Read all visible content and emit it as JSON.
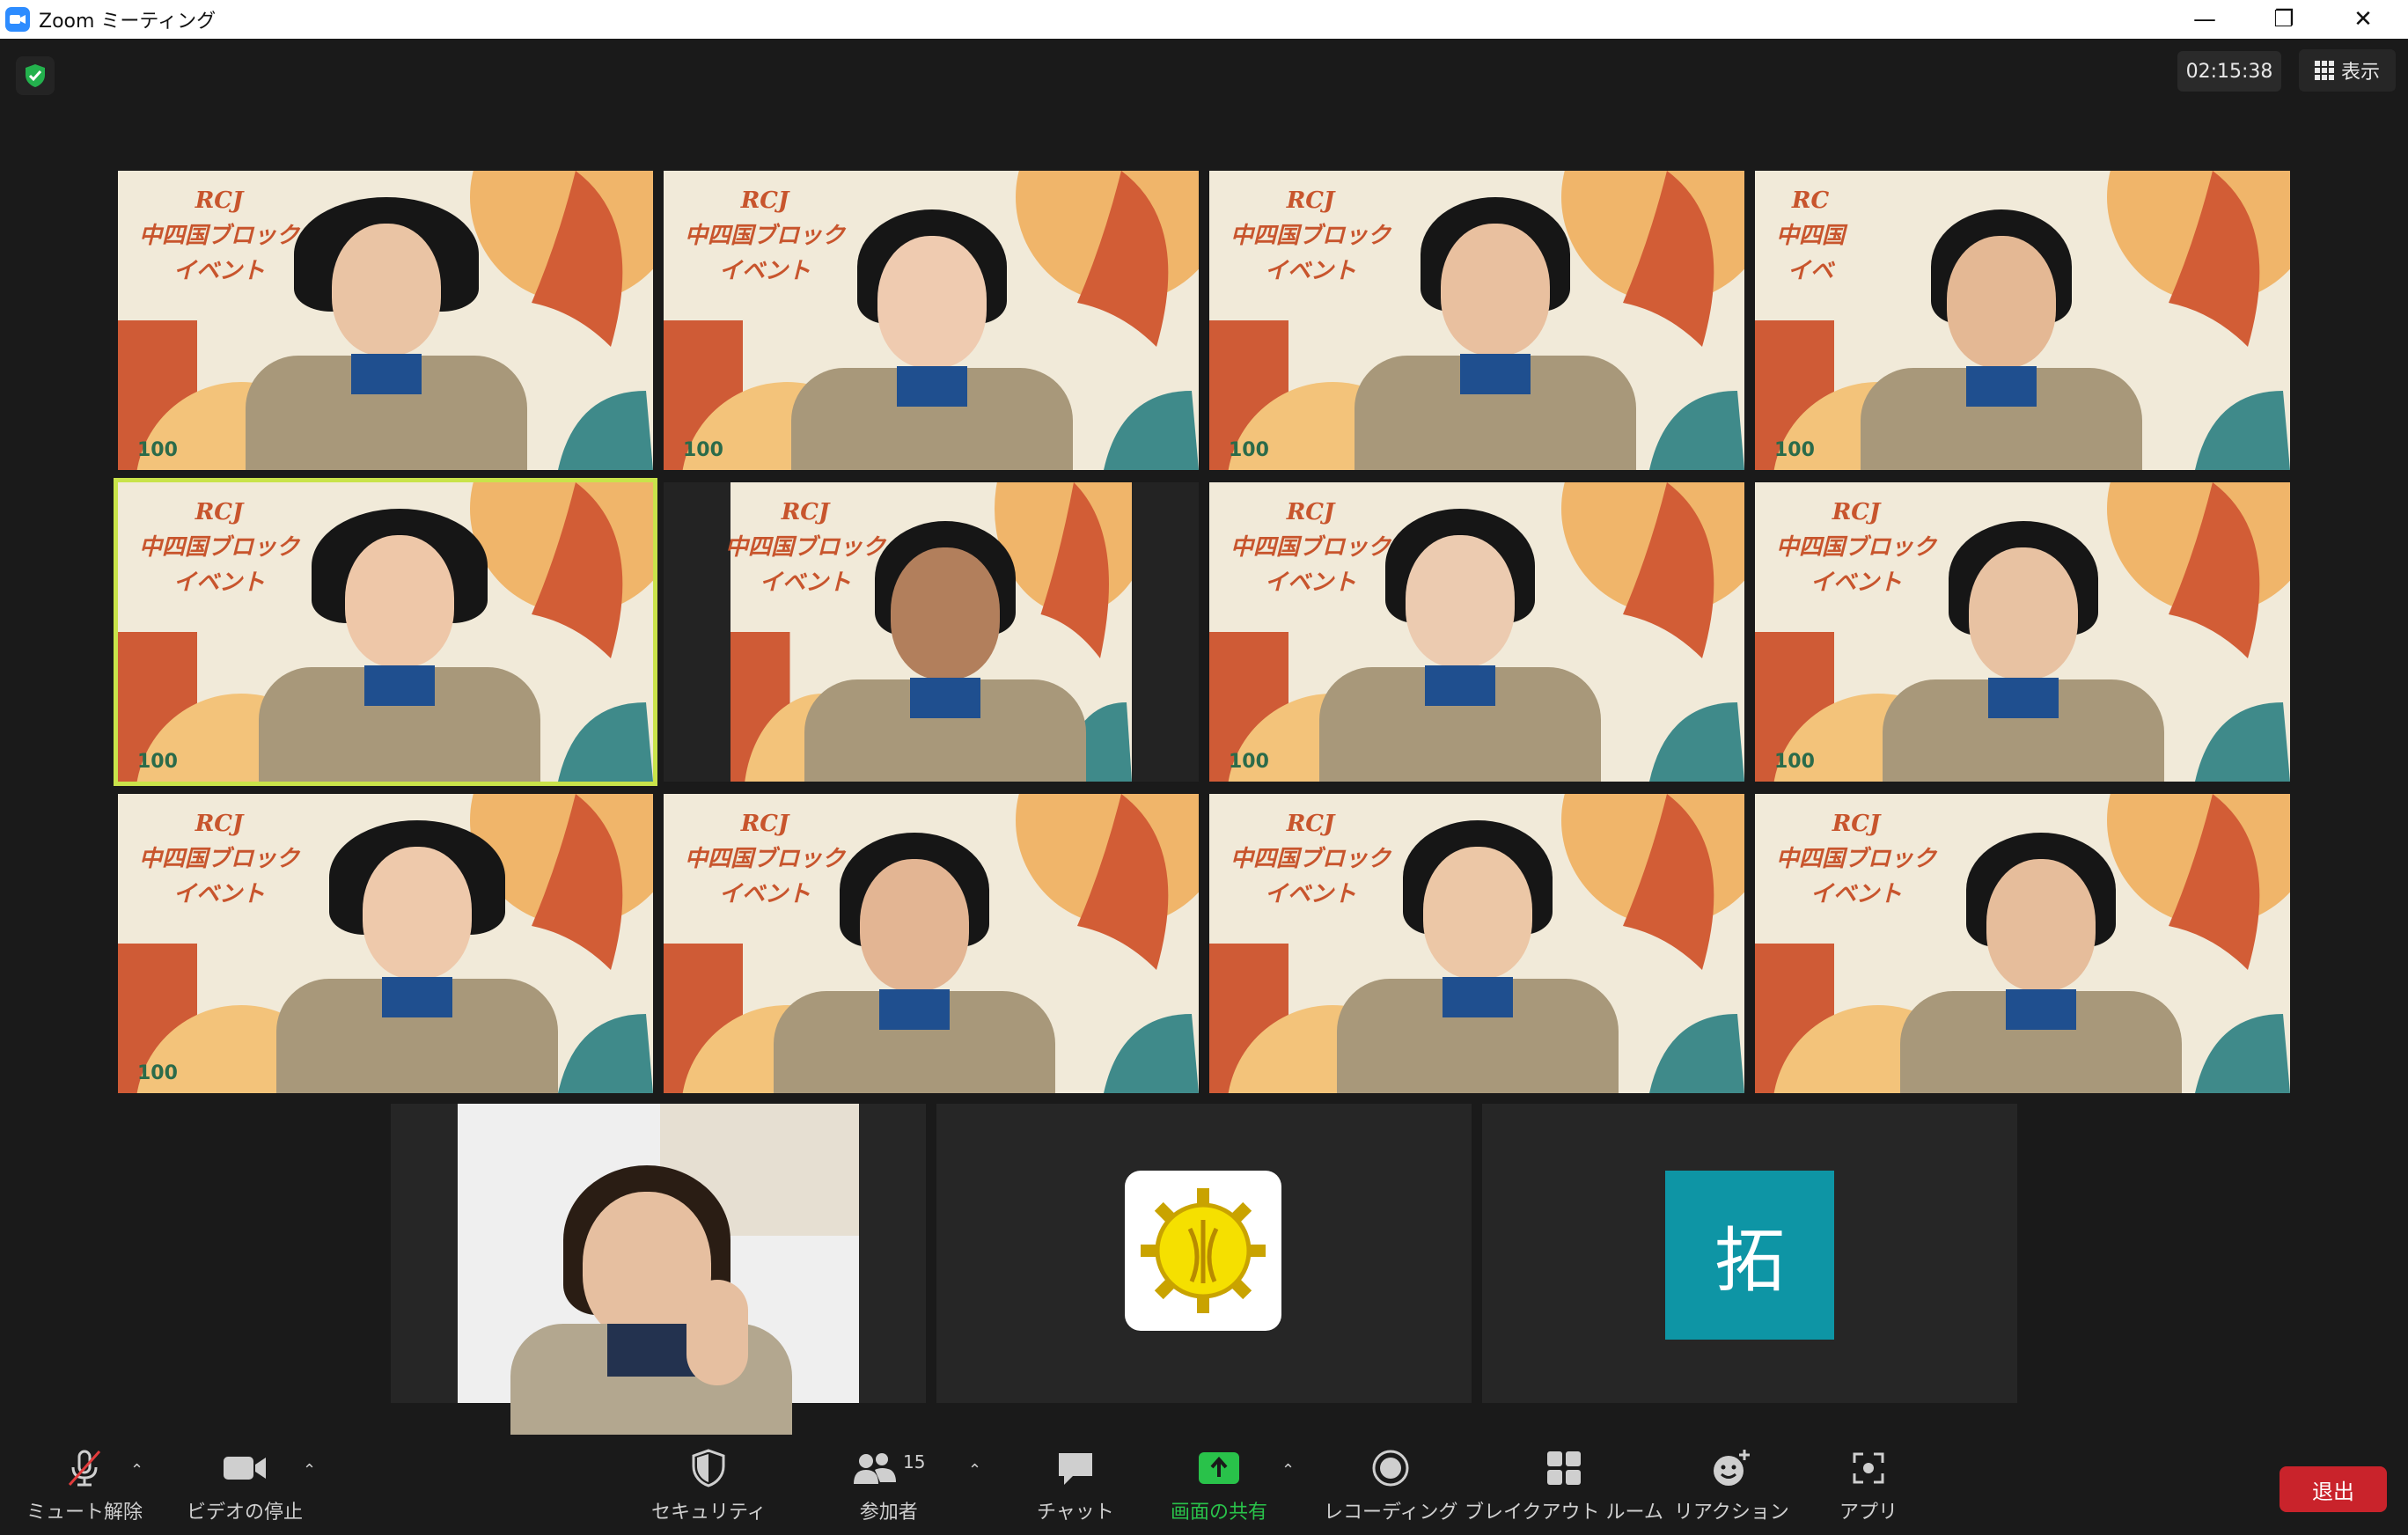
{
  "window": {
    "title": "Zoom ミーティング",
    "minimize": "—",
    "restore": "❐",
    "close": "✕"
  },
  "header": {
    "timer": "02:15:38",
    "view_label": "表示"
  },
  "tiles": [
    {
      "rcj": [
        "RCJ",
        "中四国ブロック",
        "イベント"
      ],
      "badge": "100"
    },
    {
      "rcj": [
        "RCJ",
        "中四国ブロック",
        "イベント"
      ],
      "badge": "100"
    },
    {
      "rcj": [
        "RCJ",
        "中四国ブロック",
        "イベント"
      ],
      "badge": "100"
    },
    {
      "rcj": [
        "RC",
        "中四国",
        "イベ"
      ],
      "badge": "100"
    },
    {
      "rcj": [
        "RCJ",
        "中四国ブロック",
        "イベント"
      ],
      "badge": "100"
    },
    {
      "rcj": [
        "RCJ",
        "中四国ブロック",
        "イベント"
      ],
      "badge": ""
    },
    {
      "rcj": [
        "RCJ",
        "中四国ブロック",
        "イベント"
      ],
      "badge": "100"
    },
    {
      "rcj": [
        "RCJ",
        "中四国ブロック",
        "イベント"
      ],
      "badge": "100"
    },
    {
      "rcj": [
        "RCJ",
        "中四国ブロック",
        "イベント"
      ],
      "badge": "100"
    },
    {
      "rcj": [
        "RCJ",
        "中四国ブロック",
        "イベント"
      ],
      "badge": ""
    },
    {
      "rcj": [
        "RCJ",
        "中四国ブロック",
        "イベント"
      ],
      "badge": ""
    },
    {
      "rcj": [
        "RCJ",
        "中四国ブロック",
        "イベント"
      ],
      "badge": ""
    }
  ],
  "avatars": {
    "initial": "拓"
  },
  "toolbar": {
    "unmute": "ミュート解除",
    "stop_video": "ビデオの停止",
    "security": "セキュリティ",
    "participants": "参加者",
    "participants_count": "15",
    "chat": "チャット",
    "share": "画面の共有",
    "record": "レコーディング",
    "breakout": "ブレイクアウト ルーム",
    "reactions": "リアクション",
    "apps": "アプリ",
    "leave": "退出"
  },
  "colors": {
    "share_green": "#29c24a",
    "leave_red": "#c9232b",
    "active_speaker": "#c9e34a",
    "avatar_teal": "#0e95a5"
  }
}
